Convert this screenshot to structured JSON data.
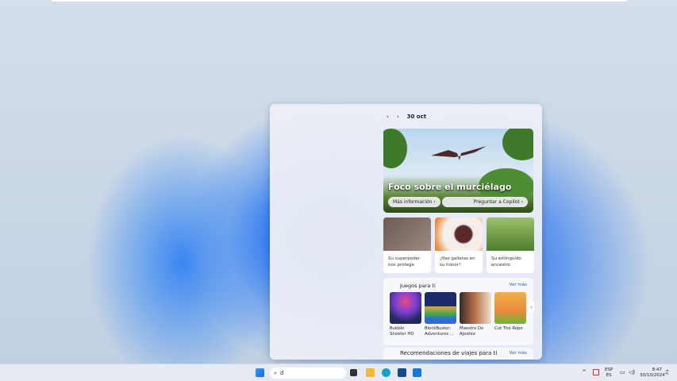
{
  "panel": {
    "date": "30 oct",
    "hero": {
      "title": "Foco sobre el murciélago",
      "more_info": "Más información",
      "ask_copilot": "Preguntar a Copilot"
    },
    "cards": [
      {
        "text": "Su superpoder nos protege"
      },
      {
        "text": "¡Haz galletas en su honor!"
      },
      {
        "text": "Su extinguido ancestro"
      }
    ],
    "games": {
      "title": "Juegos para ti",
      "see_more": "Ver más",
      "items": [
        {
          "name": "Bubble Shooter HD"
        },
        {
          "name": "BlockBuster: Adventures ..."
        },
        {
          "name": "Maestro De Ajedrez"
        },
        {
          "name": "Cut The Rope"
        }
      ]
    },
    "travel": {
      "title": "Recomendaciones de viajes para ti",
      "see_more": "Ver más"
    }
  },
  "taskbar": {
    "search_value": "d",
    "lang_top": "ESP",
    "lang_bottom": "ES",
    "time": "8:47",
    "date": "30/10/2024"
  }
}
